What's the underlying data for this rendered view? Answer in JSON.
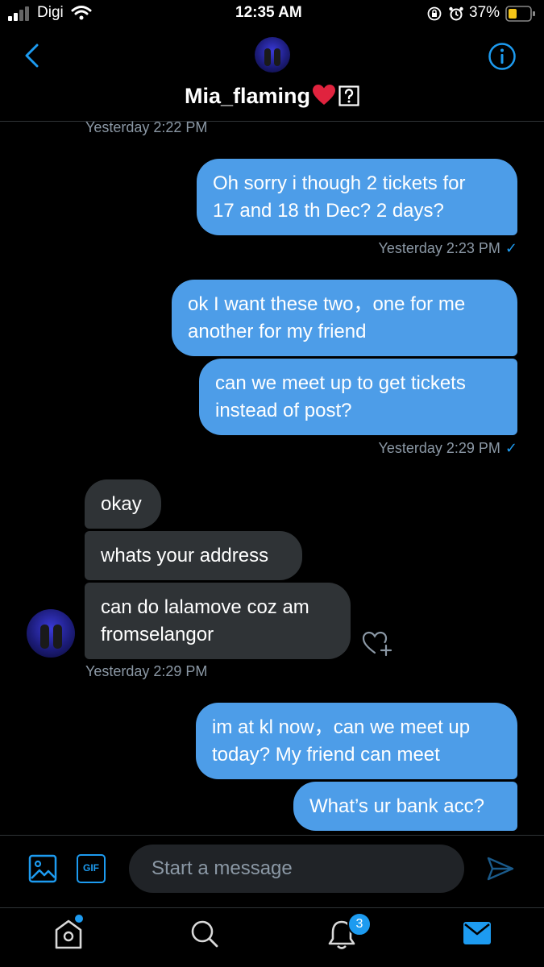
{
  "status_bar": {
    "carrier": "Digi",
    "time": "12:35 AM",
    "battery": "37%"
  },
  "header": {
    "username": "Mia_flaming",
    "back_icon": "chevron-left-icon",
    "info_icon": "info-icon"
  },
  "messages": [
    {
      "kind": "timestamp",
      "text": "Yesterday 2:22 PM"
    },
    {
      "kind": "outgoing",
      "lines": [
        "Oh sorry i though 2 tickets for",
        "17 and 18 th Dec? 2 days?"
      ]
    },
    {
      "kind": "timestamp",
      "text": "Yesterday 2:23 PM"
    },
    {
      "kind": "outgoing",
      "lines": [
        "ok I want these two，one for me",
        "another for my friend"
      ]
    },
    {
      "kind": "outgoing",
      "lines": [
        "can we meet up to get tickets",
        "instead of post?"
      ]
    },
    {
      "kind": "timestamp",
      "text": "Yesterday 2:29 PM"
    },
    {
      "kind": "incoming",
      "lines": [
        "okay"
      ]
    },
    {
      "kind": "incoming",
      "lines": [
        "whats your address"
      ]
    },
    {
      "kind": "incoming",
      "lines": [
        "can do lalamove coz am",
        "fromselangor"
      ]
    },
    {
      "kind": "timestamp",
      "text": "Yesterday 2:29 PM"
    },
    {
      "kind": "outgoing",
      "lines": [
        "im at kl now，can we meet up",
        "today? My friend can meet"
      ]
    },
    {
      "kind": "outgoing",
      "lines": [
        "What’s ur bank acc?"
      ]
    }
  ],
  "composer": {
    "placeholder": "Start a message",
    "gif_label": "GIF"
  },
  "bottom_nav": {
    "notifications_badge": "3"
  },
  "colors": {
    "outgoing_bubble": "#4d9de8",
    "incoming_bubble": "#2f3336",
    "accent": "#1d9bf0"
  }
}
